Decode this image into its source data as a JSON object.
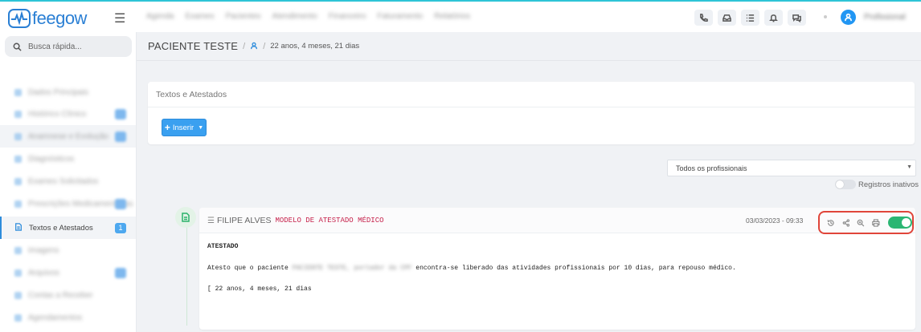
{
  "app": {
    "logo_text": "feegow",
    "accent": "#2a7fd4",
    "topline_color": "#2ec4d6"
  },
  "header": {
    "nav_items": [
      "Agenda",
      "Exames",
      "Pacientes",
      "Atendimento",
      "Financeiro",
      "Faturamento",
      "Relatórios"
    ],
    "icons": [
      "phone-icon",
      "inbox-icon",
      "list-icon",
      "bell-icon",
      "chat-icon"
    ],
    "user_name": "Profissional"
  },
  "sidebar": {
    "search_placeholder": "Busca rápida...",
    "items": [
      {
        "label": "Dados Principais"
      },
      {
        "label": "Histórico Clínico"
      },
      {
        "label": "Anamnese e Evolução"
      },
      {
        "label": "Diagnósticos"
      },
      {
        "label": "Exames Solicitados"
      },
      {
        "label": "Prescrições Medicamentosas"
      },
      {
        "label": "Textos e Atestados",
        "badge": "1"
      },
      {
        "label": "Imagens"
      },
      {
        "label": "Arquivos"
      },
      {
        "label": "Contas a Receber"
      },
      {
        "label": "Agendamentos"
      }
    ]
  },
  "breadcrumb": {
    "patient": "PACIENTE TESTE",
    "sep": "/",
    "age": "22 anos, 4 meses, 21 dias"
  },
  "panel": {
    "title": "Textos e Atestados",
    "insert_label": "Inserir"
  },
  "filters": {
    "professional_select": "Todos os profissionais",
    "inactive_label": "Registros inativos"
  },
  "document": {
    "professional": "FILIPE ALVES",
    "model": "MODELO DE ATESTADO MÉDICO",
    "datetime": "03/03/2023 - 09:33",
    "line1": "ATESTADO",
    "line2_a": "Atesto que o paciente",
    "line2_hidden": "PACIENTE TESTE, portador da CPF",
    "line2_b": " encontra-se liberado das atividades profissionais por 10 dias, para repouso médico.",
    "line3": "[ 22 anos, 4 meses, 21 dias",
    "active": true,
    "toggle_color": "#2bb673",
    "highlight_color": "#e0453a"
  }
}
